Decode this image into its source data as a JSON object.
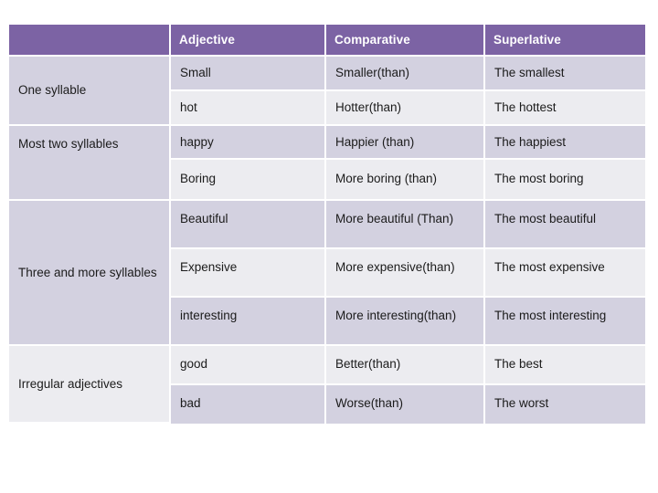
{
  "table": {
    "headers": [
      "",
      "Adjective",
      "Comparative",
      "Superlative"
    ],
    "groups": [
      {
        "label": "One syllable",
        "rows": [
          {
            "adjective": "Small",
            "comparative": "Smaller(than)",
            "superlative": "The smallest"
          },
          {
            "adjective": "hot",
            "comparative": "Hotter(than)",
            "superlative": "The hottest"
          }
        ]
      },
      {
        "label": "Most  two syllables",
        "rows": [
          {
            "adjective": "happy",
            "comparative": "Happier (than)",
            "superlative": "The happiest"
          },
          {
            "adjective": "Boring",
            "comparative": "More boring (than)",
            "superlative": "The most boring"
          }
        ]
      },
      {
        "label": "Three and more syllables",
        "rows": [
          {
            "adjective": "Beautiful",
            "comparative": "More beautiful (Than)",
            "superlative": "The most beautiful"
          },
          {
            "adjective": "Expensive",
            "comparative": "More expensive(than)",
            "superlative": "The most expensive"
          },
          {
            "adjective": "interesting",
            "comparative": "More interesting(than)",
            "superlative": "The most interesting"
          }
        ]
      },
      {
        "label": "Irregular adjectives",
        "rows": [
          {
            "adjective": "good",
            "comparative": "Better(than)",
            "superlative": "The best"
          },
          {
            "adjective": "bad",
            "comparative": "Worse(than)",
            "superlative": "The worst"
          }
        ]
      }
    ]
  },
  "colors": {
    "header_purple": "#7c63a4",
    "band_dark": "#d3d1e0",
    "band_light": "#ececf0",
    "text": "#1b1b1b",
    "header_text": "#ffffff",
    "page_background": "#ffffff"
  }
}
